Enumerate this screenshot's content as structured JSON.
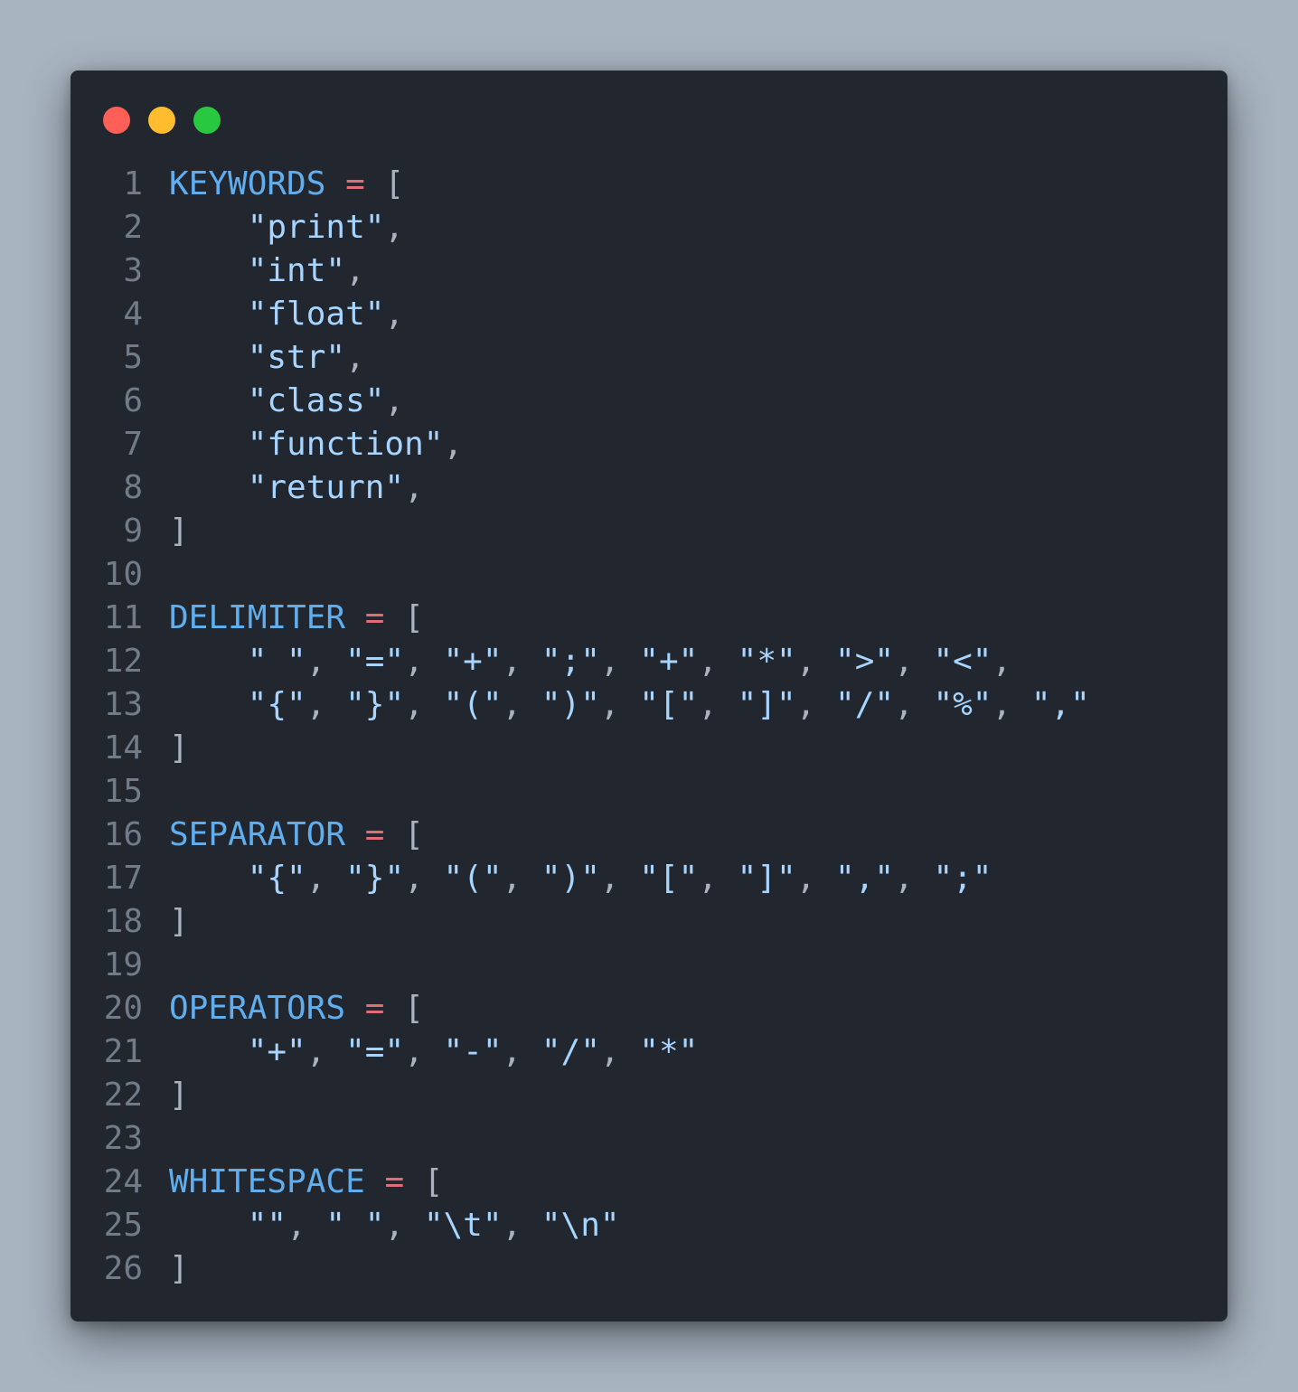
{
  "window": {
    "controls": [
      {
        "name": "close",
        "color": "#fe5f57"
      },
      {
        "name": "minimize",
        "color": "#febc2e"
      },
      {
        "name": "maximize",
        "color": "#28c840"
      }
    ]
  },
  "code": {
    "lines": [
      {
        "n": "1",
        "tokens": [
          {
            "t": "id",
            "v": "KEYWORDS"
          },
          {
            "t": "pl",
            "v": " "
          },
          {
            "t": "op",
            "v": "="
          },
          {
            "t": "pl",
            "v": " ["
          }
        ]
      },
      {
        "n": "2",
        "tokens": [
          {
            "t": "pl",
            "v": "    "
          },
          {
            "t": "st",
            "v": "\"print\""
          },
          {
            "t": "pl",
            "v": ","
          }
        ]
      },
      {
        "n": "3",
        "tokens": [
          {
            "t": "pl",
            "v": "    "
          },
          {
            "t": "st",
            "v": "\"int\""
          },
          {
            "t": "pl",
            "v": ","
          }
        ]
      },
      {
        "n": "4",
        "tokens": [
          {
            "t": "pl",
            "v": "    "
          },
          {
            "t": "st",
            "v": "\"float\""
          },
          {
            "t": "pl",
            "v": ","
          }
        ]
      },
      {
        "n": "5",
        "tokens": [
          {
            "t": "pl",
            "v": "    "
          },
          {
            "t": "st",
            "v": "\"str\""
          },
          {
            "t": "pl",
            "v": ","
          }
        ]
      },
      {
        "n": "6",
        "tokens": [
          {
            "t": "pl",
            "v": "    "
          },
          {
            "t": "st",
            "v": "\"class\""
          },
          {
            "t": "pl",
            "v": ","
          }
        ]
      },
      {
        "n": "7",
        "tokens": [
          {
            "t": "pl",
            "v": "    "
          },
          {
            "t": "st",
            "v": "\"function\""
          },
          {
            "t": "pl",
            "v": ","
          }
        ]
      },
      {
        "n": "8",
        "tokens": [
          {
            "t": "pl",
            "v": "    "
          },
          {
            "t": "st",
            "v": "\"return\""
          },
          {
            "t": "pl",
            "v": ","
          }
        ]
      },
      {
        "n": "9",
        "tokens": [
          {
            "t": "pl",
            "v": "]"
          }
        ]
      },
      {
        "n": "10",
        "tokens": []
      },
      {
        "n": "11",
        "tokens": [
          {
            "t": "id",
            "v": "DELIMITER"
          },
          {
            "t": "pl",
            "v": " "
          },
          {
            "t": "op",
            "v": "="
          },
          {
            "t": "pl",
            "v": " ["
          }
        ]
      },
      {
        "n": "12",
        "tokens": [
          {
            "t": "pl",
            "v": "    "
          },
          {
            "t": "st",
            "v": "\" \""
          },
          {
            "t": "pl",
            "v": ", "
          },
          {
            "t": "st",
            "v": "\"=\""
          },
          {
            "t": "pl",
            "v": ", "
          },
          {
            "t": "st",
            "v": "\"+\""
          },
          {
            "t": "pl",
            "v": ", "
          },
          {
            "t": "st",
            "v": "\";\""
          },
          {
            "t": "pl",
            "v": ", "
          },
          {
            "t": "st",
            "v": "\"+\""
          },
          {
            "t": "pl",
            "v": ", "
          },
          {
            "t": "st",
            "v": "\"*\""
          },
          {
            "t": "pl",
            "v": ", "
          },
          {
            "t": "st",
            "v": "\">\""
          },
          {
            "t": "pl",
            "v": ", "
          },
          {
            "t": "st",
            "v": "\"<\""
          },
          {
            "t": "pl",
            "v": ","
          }
        ]
      },
      {
        "n": "13",
        "tokens": [
          {
            "t": "pl",
            "v": "    "
          },
          {
            "t": "st",
            "v": "\"{\""
          },
          {
            "t": "pl",
            "v": ", "
          },
          {
            "t": "st",
            "v": "\"}\""
          },
          {
            "t": "pl",
            "v": ", "
          },
          {
            "t": "st",
            "v": "\"(\""
          },
          {
            "t": "pl",
            "v": ", "
          },
          {
            "t": "st",
            "v": "\")\""
          },
          {
            "t": "pl",
            "v": ", "
          },
          {
            "t": "st",
            "v": "\"[\""
          },
          {
            "t": "pl",
            "v": ", "
          },
          {
            "t": "st",
            "v": "\"]\""
          },
          {
            "t": "pl",
            "v": ", "
          },
          {
            "t": "st",
            "v": "\"/\""
          },
          {
            "t": "pl",
            "v": ", "
          },
          {
            "t": "st",
            "v": "\"%\""
          },
          {
            "t": "pl",
            "v": ", "
          },
          {
            "t": "st",
            "v": "\",\""
          }
        ]
      },
      {
        "n": "14",
        "tokens": [
          {
            "t": "pl",
            "v": "]"
          }
        ]
      },
      {
        "n": "15",
        "tokens": []
      },
      {
        "n": "16",
        "tokens": [
          {
            "t": "id",
            "v": "SEPARATOR"
          },
          {
            "t": "pl",
            "v": " "
          },
          {
            "t": "op",
            "v": "="
          },
          {
            "t": "pl",
            "v": " ["
          }
        ]
      },
      {
        "n": "17",
        "tokens": [
          {
            "t": "pl",
            "v": "    "
          },
          {
            "t": "st",
            "v": "\"{\""
          },
          {
            "t": "pl",
            "v": ", "
          },
          {
            "t": "st",
            "v": "\"}\""
          },
          {
            "t": "pl",
            "v": ", "
          },
          {
            "t": "st",
            "v": "\"(\""
          },
          {
            "t": "pl",
            "v": ", "
          },
          {
            "t": "st",
            "v": "\")\""
          },
          {
            "t": "pl",
            "v": ", "
          },
          {
            "t": "st",
            "v": "\"[\""
          },
          {
            "t": "pl",
            "v": ", "
          },
          {
            "t": "st",
            "v": "\"]\""
          },
          {
            "t": "pl",
            "v": ", "
          },
          {
            "t": "st",
            "v": "\",\""
          },
          {
            "t": "pl",
            "v": ", "
          },
          {
            "t": "st",
            "v": "\";\""
          }
        ]
      },
      {
        "n": "18",
        "tokens": [
          {
            "t": "pl",
            "v": "]"
          }
        ]
      },
      {
        "n": "19",
        "tokens": []
      },
      {
        "n": "20",
        "tokens": [
          {
            "t": "id",
            "v": "OPERATORS"
          },
          {
            "t": "pl",
            "v": " "
          },
          {
            "t": "op",
            "v": "="
          },
          {
            "t": "pl",
            "v": " ["
          }
        ]
      },
      {
        "n": "21",
        "tokens": [
          {
            "t": "pl",
            "v": "    "
          },
          {
            "t": "st",
            "v": "\"+\""
          },
          {
            "t": "pl",
            "v": ", "
          },
          {
            "t": "st",
            "v": "\"=\""
          },
          {
            "t": "pl",
            "v": ", "
          },
          {
            "t": "st",
            "v": "\"-\""
          },
          {
            "t": "pl",
            "v": ", "
          },
          {
            "t": "st",
            "v": "\"/\""
          },
          {
            "t": "pl",
            "v": ", "
          },
          {
            "t": "st",
            "v": "\"*\""
          }
        ]
      },
      {
        "n": "22",
        "tokens": [
          {
            "t": "pl",
            "v": "]"
          }
        ]
      },
      {
        "n": "23",
        "tokens": []
      },
      {
        "n": "24",
        "tokens": [
          {
            "t": "id",
            "v": "WHITESPACE"
          },
          {
            "t": "pl",
            "v": " "
          },
          {
            "t": "op",
            "v": "="
          },
          {
            "t": "pl",
            "v": " ["
          }
        ]
      },
      {
        "n": "25",
        "tokens": [
          {
            "t": "pl",
            "v": "    "
          },
          {
            "t": "st",
            "v": "\"\""
          },
          {
            "t": "pl",
            "v": ", "
          },
          {
            "t": "st",
            "v": "\" \""
          },
          {
            "t": "pl",
            "v": ", "
          },
          {
            "t": "st",
            "v": "\"\\t\""
          },
          {
            "t": "pl",
            "v": ", "
          },
          {
            "t": "st",
            "v": "\"\\n\""
          }
        ]
      },
      {
        "n": "26",
        "tokens": [
          {
            "t": "pl",
            "v": "]"
          }
        ]
      }
    ]
  }
}
